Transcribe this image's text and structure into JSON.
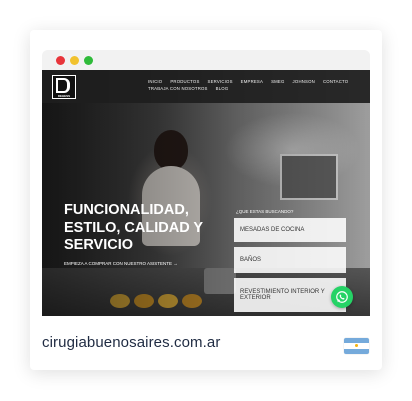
{
  "site_url": "cirugiabuenosaires.com.ar",
  "window": {
    "controls": [
      "close",
      "minimize",
      "maximize"
    ]
  },
  "navbar": {
    "logo_text": "DEHESS",
    "row1": [
      "INICIO",
      "PRODUCTOS",
      "SERVICIOS",
      "EMPRESA",
      "SMEG",
      "JOHNSON",
      "CONTACTO"
    ],
    "row2": [
      "TRABAJA CON NOSOTROS",
      "BLOG"
    ]
  },
  "hero": {
    "headline_lines": [
      "FUNCIONALIDAD,",
      "ESTILO, CALIDAD Y",
      "SERVICIO"
    ],
    "cta": "EMPIEZA A COMPRAR CON NUESTRO ASISTENTE →"
  },
  "search_panel": {
    "label": "¿QUE ESTAS BUSCANDO?",
    "options": [
      "MESADAS DE COCINA",
      "BAÑOS",
      "REVESTIMIENTO INTERIOR Y EXTERIOR"
    ]
  },
  "icons": {
    "whatsapp": "whatsapp-icon",
    "flag": "argentina-flag-icon"
  },
  "colors": {
    "url_text": "#1f2b42",
    "whatsapp_green": "#25d366",
    "flag_blue": "#75aadb"
  }
}
